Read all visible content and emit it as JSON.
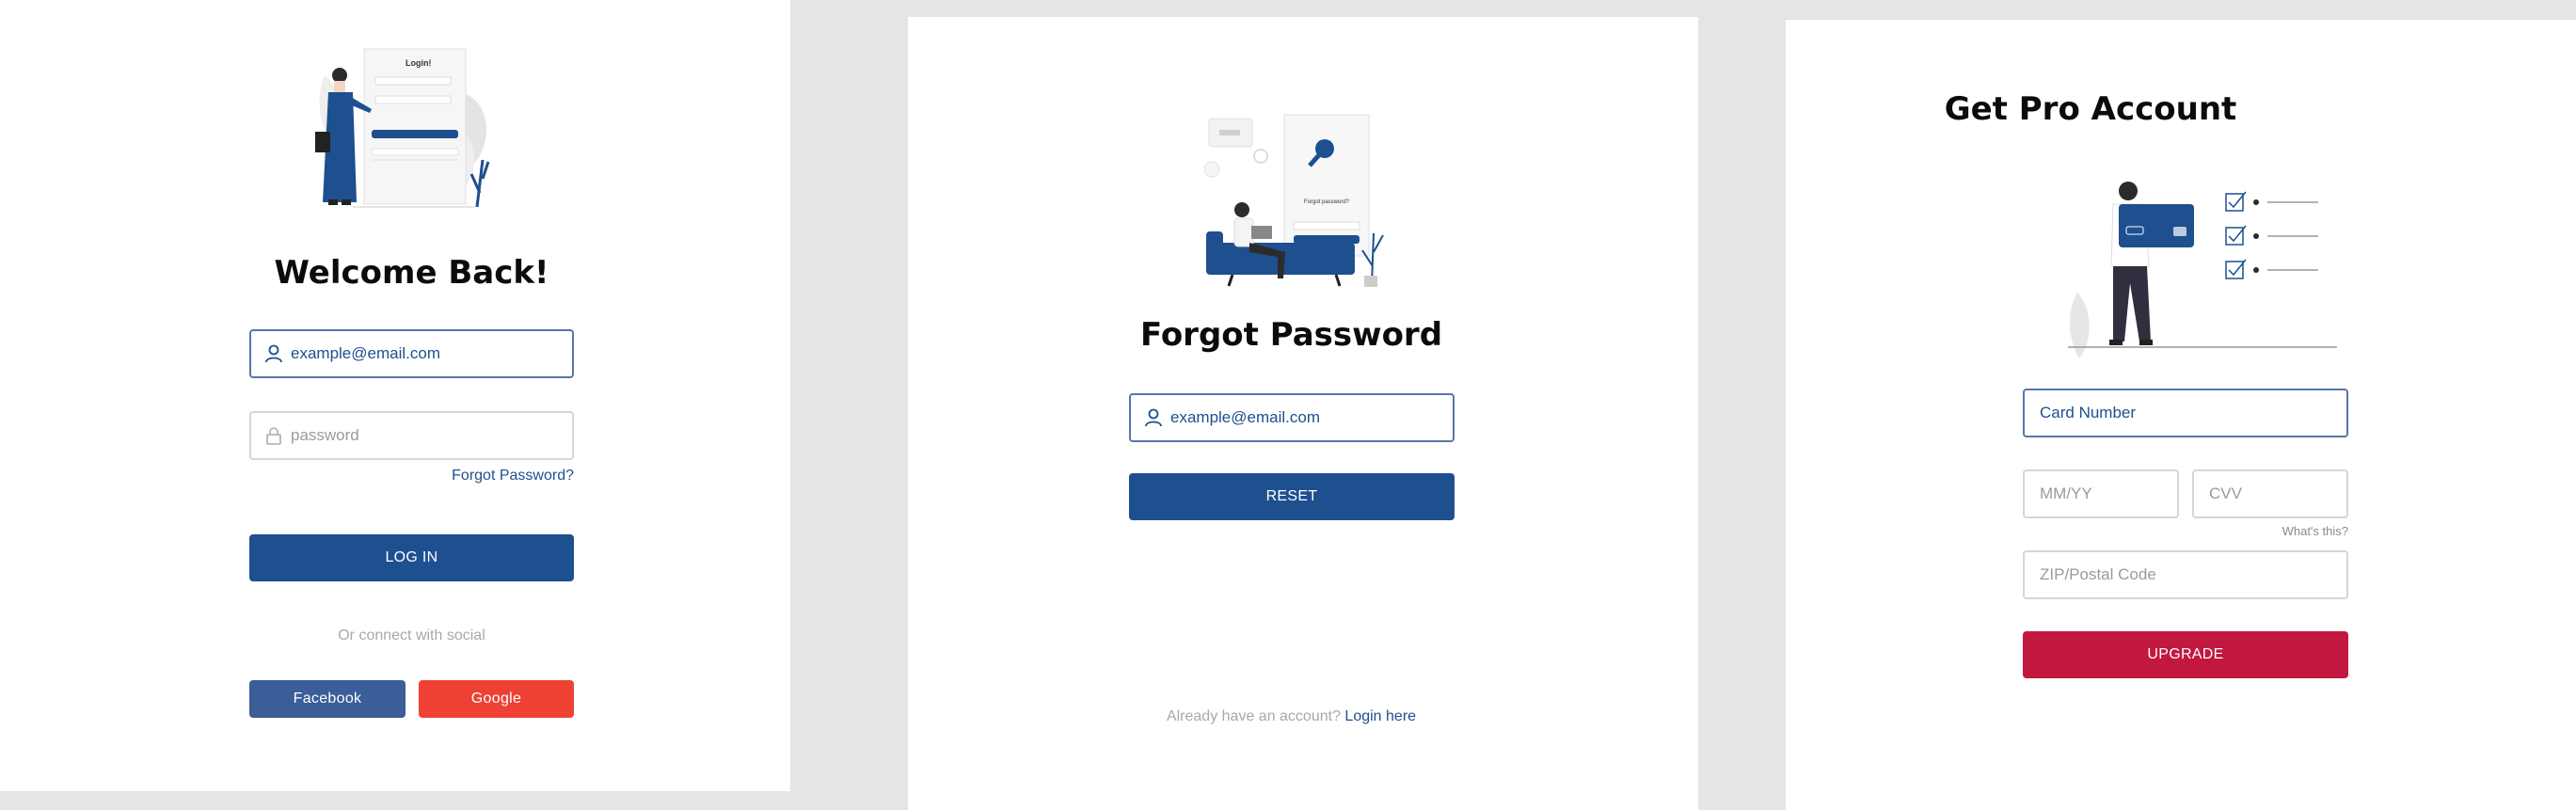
{
  "colors": {
    "primary": "#1e4f8f",
    "facebook": "#3b5d98",
    "google": "#ef4133",
    "upgrade": "#c2173f",
    "background": "#e5e5e5"
  },
  "login": {
    "title": "Welcome Back!",
    "illustration_title": "Login!",
    "email": {
      "value": "example@email.com",
      "icon": "user-icon"
    },
    "password": {
      "placeholder": "password",
      "icon": "lock-icon"
    },
    "forgot_link": "Forgot Password?",
    "login_button": "LOG IN",
    "social_text": "Or connect with social",
    "facebook_button": "Facebook",
    "google_button": "Google"
  },
  "forgot": {
    "title": "Forgot Password",
    "illustration_title": "Forgot password?",
    "email": {
      "value": "example@email.com",
      "icon": "user-icon"
    },
    "reset_button": "RESET",
    "footer_text": "Already have an account?",
    "footer_link": "Login here"
  },
  "pro": {
    "title": "Get Pro Account",
    "card_number": "Card Number",
    "expiry_placeholder": "MM/YY",
    "cvv_placeholder": "CVV",
    "cvv_help": "What's this?",
    "zip_placeholder": "ZIP/Postal Code",
    "upgrade_button": "UPGRADE"
  }
}
